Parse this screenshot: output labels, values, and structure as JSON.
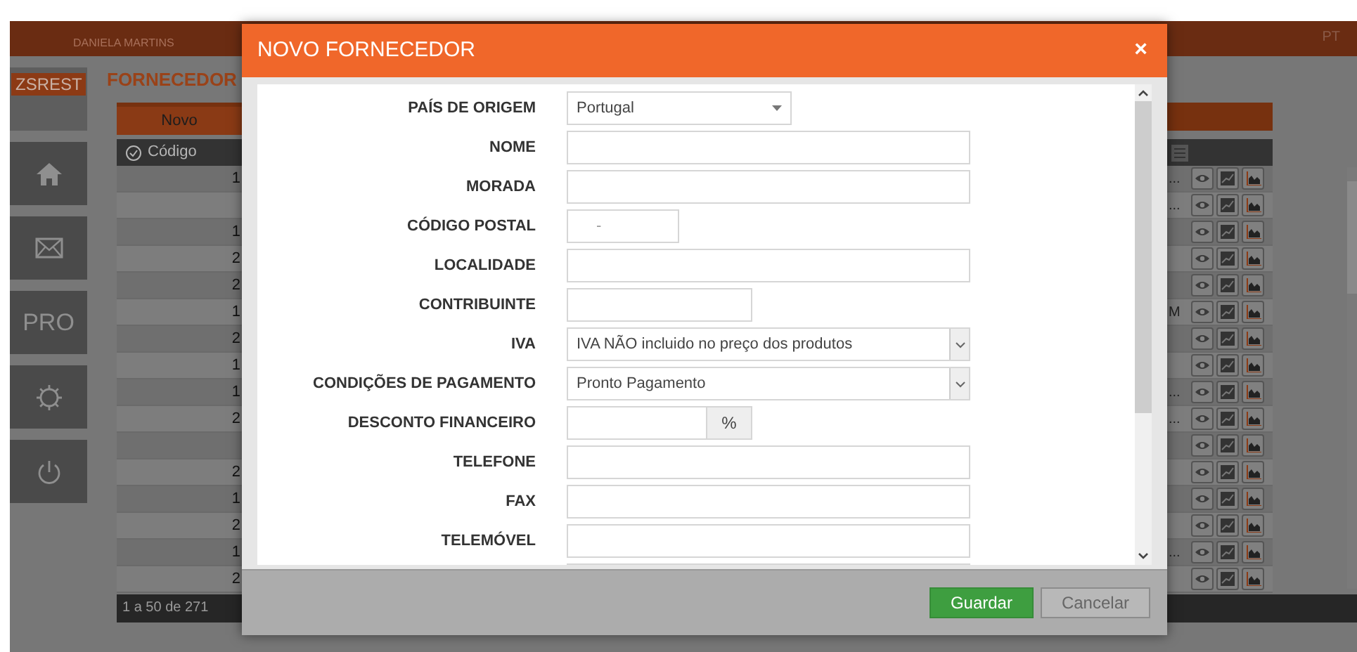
{
  "header": {
    "user": "DANIELA MARTINS",
    "language": "PT"
  },
  "sidebar": {
    "badge": "ZSREST",
    "items": [
      {
        "kind": "home"
      },
      {
        "kind": "mail"
      },
      {
        "kind": "text",
        "label": "PRO"
      },
      {
        "kind": "settings"
      },
      {
        "kind": "power"
      }
    ]
  },
  "page": {
    "title": "FORNECEDOR",
    "tab": "Novo",
    "table": {
      "columns": [
        "Código"
      ],
      "rows": [
        {
          "code": "1",
          "tail": "..."
        },
        {
          "code": "",
          "tail": "..."
        },
        {
          "code": "1"
        },
        {
          "code": "2"
        },
        {
          "code": "2"
        },
        {
          "code": "1",
          "tail": "M"
        },
        {
          "code": "2"
        },
        {
          "code": "1"
        },
        {
          "code": "1",
          "tail": "..."
        },
        {
          "code": "2",
          "tail": "..."
        },
        {
          "code": ""
        },
        {
          "code": "2"
        },
        {
          "code": "1"
        },
        {
          "code": "2"
        },
        {
          "code": "1",
          "tail": "..."
        },
        {
          "code": "2"
        }
      ]
    },
    "pager": "1 a 50 de 271"
  },
  "modal": {
    "title": "NOVO FORNECEDOR",
    "close": "×",
    "fields": [
      {
        "label": "PAÍS DE ORIGEM",
        "kind": "dropdown",
        "value": "Portugal"
      },
      {
        "label": "NOME",
        "kind": "text"
      },
      {
        "label": "MORADA",
        "kind": "text"
      },
      {
        "label": "CÓDIGO POSTAL",
        "kind": "postal",
        "placeholder": "-"
      },
      {
        "label": "LOCALIDADE",
        "kind": "text"
      },
      {
        "label": "CONTRIBUINTE",
        "kind": "short_text"
      },
      {
        "label": "IVA",
        "kind": "select",
        "value": "IVA NÃO incluido no preço dos produtos"
      },
      {
        "label": "CONDIÇÕES DE PAGAMENTO",
        "kind": "select",
        "value": "Pronto Pagamento"
      },
      {
        "label": "DESCONTO FINANCEIRO",
        "kind": "percent",
        "addon": "%"
      },
      {
        "label": "TELEFONE",
        "kind": "text"
      },
      {
        "label": "FAX",
        "kind": "text"
      },
      {
        "label": "TELEMÓVEL",
        "kind": "text"
      },
      {
        "kind": "text"
      }
    ],
    "buttons": [
      {
        "label": "Guardar",
        "kind": "primary"
      },
      {
        "label": "Cancelar",
        "kind": "secondary"
      }
    ]
  }
}
